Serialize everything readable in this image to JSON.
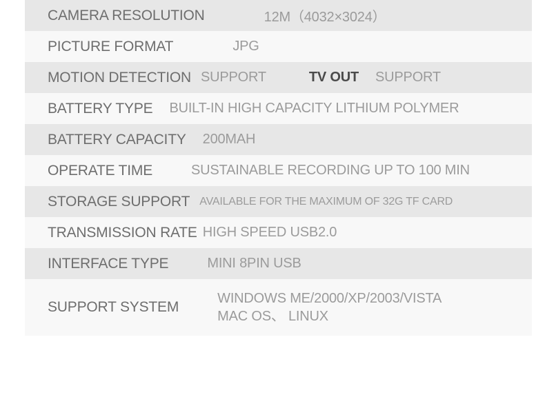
{
  "table": {
    "rows": [
      {
        "label": "CAMERA RESOLUTION",
        "value": "12M（4032×3024）"
      },
      {
        "label": "PICTURE FORMAT",
        "value": "JPG"
      },
      {
        "label": "MOTION DETECTION",
        "value": "SUPPORT",
        "label2": "TV OUT",
        "value2": "SUPPORT"
      },
      {
        "label": "BATTERY TYPE",
        "value": "BUILT-IN HIGH CAPACITY LITHIUM POLYMER"
      },
      {
        "label": "BATTERY CAPACITY",
        "value": "200MAH"
      },
      {
        "label": "OPERATE TIME",
        "value": "SUSTAINABLE RECORDING UP TO 100 MIN"
      },
      {
        "label": "STORAGE SUPPORT",
        "value": "AVAILABLE FOR THE MAXIMUM OF 32G TF CARD"
      },
      {
        "label": "TRANSMISSION RATE",
        "value": "HIGH SPEED USB2.0"
      },
      {
        "label": "INTERFACE TYPE",
        "value": "MINI 8PIN USB"
      },
      {
        "label": "SUPPORT SYSTEM",
        "value_line1": "WINDOWS ME/2000/XP/2003/VISTA",
        "value_line2": "MAC OS、 LINUX"
      }
    ]
  },
  "colors": {
    "row_dark": "#e7e7e7",
    "row_light": "#f8f8f8",
    "label_text": "#6e6e6e",
    "value_text": "#9b9b9b",
    "bold_label_text": "#4a4a4a",
    "page_background": "#ffffff"
  }
}
